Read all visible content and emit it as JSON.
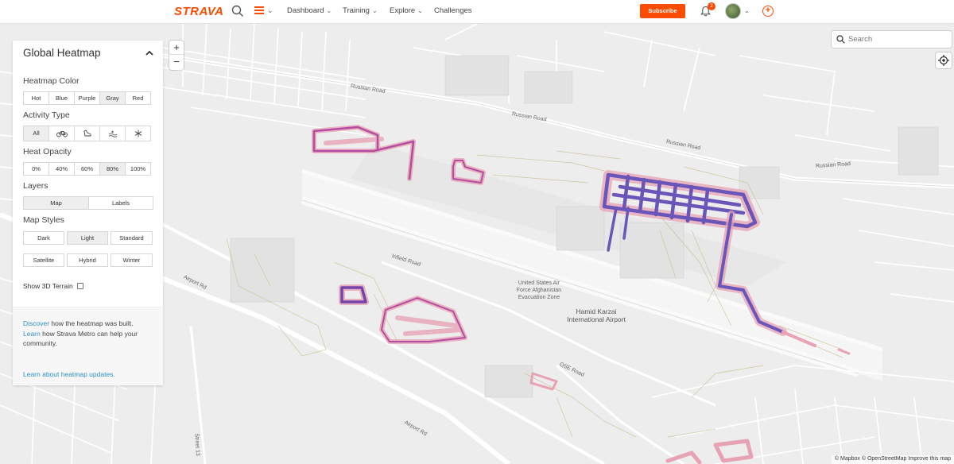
{
  "brand": {
    "logo": "STRAVA",
    "accent": "#fc4c02"
  },
  "nav": {
    "links": [
      {
        "label": "Dashboard",
        "chevron": true
      },
      {
        "label": "Training",
        "chevron": true
      },
      {
        "label": "Explore",
        "chevron": true
      },
      {
        "label": "Challenges",
        "chevron": false
      }
    ],
    "subscribe_label": "Subscribe",
    "notification_count": "2",
    "icons": [
      "search-icon",
      "menu-icon",
      "bell-icon",
      "avatar",
      "add-icon"
    ]
  },
  "panel": {
    "title": "Global Heatmap",
    "heatmap_color": {
      "label": "Heatmap Color",
      "options": [
        "Hot",
        "Blue",
        "Purple",
        "Gray",
        "Red"
      ],
      "selected": "Gray"
    },
    "activity_type": {
      "label": "Activity Type",
      "options": [
        {
          "label": "All",
          "icon": ""
        },
        {
          "label": "",
          "icon": "bike-icon"
        },
        {
          "label": "",
          "icon": "run-shoe-icon"
        },
        {
          "label": "",
          "icon": "water-icon"
        },
        {
          "label": "",
          "icon": "snowflake-icon"
        }
      ],
      "selected": "All"
    },
    "heat_opacity": {
      "label": "Heat Opacity",
      "options": [
        "0%",
        "40%",
        "60%",
        "80%",
        "100%"
      ],
      "selected": "80%"
    },
    "layers": {
      "label": "Layers",
      "options": [
        "Map",
        "Labels"
      ],
      "selected": "Map"
    },
    "map_styles": {
      "label": "Map Styles",
      "options": [
        "Dark",
        "Light",
        "Standard",
        "Satellite",
        "Hybrid",
        "Winter"
      ],
      "selected": "Light"
    },
    "show_3d_label": "Show 3D Terrain",
    "show_3d_checked": false,
    "info": {
      "discover_link": "Discover",
      "discover_text": " how the heatmap was built.",
      "learn_link": "Learn",
      "learn_text": " how Strava Metro can help your community.",
      "updates_link": "Learn about heatmap updates."
    }
  },
  "map": {
    "search_placeholder": "Search",
    "zoom_in": "+",
    "zoom_out": "−",
    "labels": {
      "russian_road_1": "Russian Road",
      "russian_road_2": "Russian Road",
      "russian_road_3": "Russian Road",
      "russian_road_4": "Russian Road",
      "infield_road": "Infield Road",
      "airport_rd_1": "Airport Rd",
      "airport_rd_2": "Airport Rd",
      "ose_road": "OSE Road",
      "street_13": "Street 13",
      "usaf_zone": "United States Air Force Afghanistan Evacuation Zone",
      "airport": "Hamid Karzai International Airport"
    },
    "attribution": "© Mapbox © OpenStreetMap Improve this map"
  }
}
